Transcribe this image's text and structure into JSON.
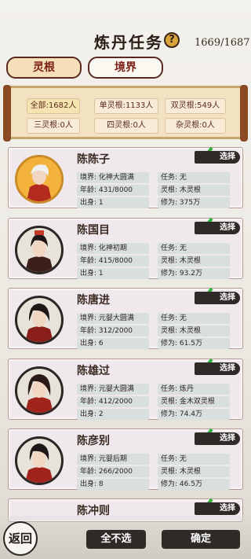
{
  "header": {
    "title": "炼丹任务",
    "help_icon": "?",
    "counter": "1669/1687"
  },
  "tabs": [
    {
      "label": "灵根",
      "active": true
    },
    {
      "label": "境界",
      "active": false
    }
  ],
  "filters": [
    {
      "label": "全部:1682人",
      "active": true
    },
    {
      "label": "单灵根:1133人"
    },
    {
      "label": "双灵根:549人"
    },
    {
      "label": "三灵根:0人"
    },
    {
      "label": "四灵根:0人"
    },
    {
      "label": "杂灵根:0人"
    }
  ],
  "labels": {
    "realm": "境界: ",
    "age": "年龄: ",
    "origin": "出身: ",
    "task": "任务: ",
    "spirit_root": "灵根: ",
    "cultivation": "修为: ",
    "select": "选择"
  },
  "disciples": [
    {
      "name": "陈陈子",
      "realm": "化神大圆满",
      "age": "431/8000",
      "origin": "1",
      "task": "无",
      "root": "木灵根",
      "cultivation": "375万"
    },
    {
      "name": "陈国目",
      "realm": "化神初期",
      "age": "415/8000",
      "origin": "1",
      "task": "无",
      "root": "木灵根",
      "cultivation": "93.2万"
    },
    {
      "name": "陈唐进",
      "realm": "元婴大圆满",
      "age": "312/2000",
      "origin": "6",
      "task": "无",
      "root": "木灵根",
      "cultivation": "61.5万"
    },
    {
      "name": "陈雄过",
      "realm": "元婴大圆满",
      "age": "412/2000",
      "origin": "2",
      "task": "炼丹",
      "root": "金木双灵根",
      "cultivation": "74.4万"
    },
    {
      "name": "陈彦别",
      "realm": "元婴后期",
      "age": "266/2000",
      "origin": "8",
      "task": "无",
      "root": "木灵根",
      "cultivation": "46.5万"
    },
    {
      "name": "陈冲则"
    }
  ],
  "bottom": {
    "back_label": "返回",
    "deselect_all": "全不选",
    "confirm": "确定"
  }
}
